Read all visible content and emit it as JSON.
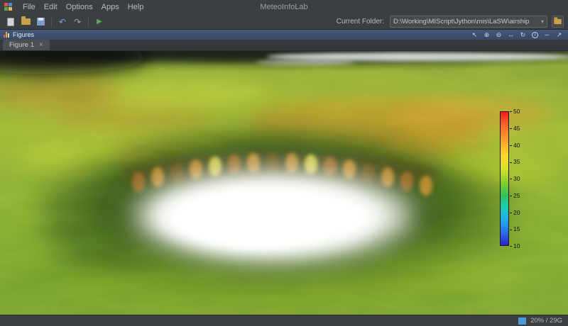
{
  "window": {
    "title": "MeteoInfoLab"
  },
  "menubar": {
    "items": [
      "File",
      "Edit",
      "Options",
      "Apps",
      "Help"
    ]
  },
  "toolbar": {
    "current_folder_label": "Current Folder:",
    "current_folder_value": "D:\\Working\\MIScript\\Jython\\mis\\LaSW\\airship"
  },
  "figures_panel": {
    "title": "Figures"
  },
  "tabs": [
    {
      "label": "Figure 1",
      "close": "×"
    }
  ],
  "figure": {
    "colorbar": {
      "min": 10,
      "max": 50,
      "ticks": [
        "50",
        "45",
        "40",
        "35",
        "30",
        "25",
        "20",
        "15",
        "10"
      ],
      "gradient_top_to_bottom": [
        "#f41b1f",
        "#f8662a",
        "#fba12c",
        "#ffd92b",
        "#d3e32b",
        "#7ecb2f",
        "#2fc25b",
        "#1ccdb9",
        "#22a5ee",
        "#2a64e2",
        "#2d1fd0"
      ]
    }
  },
  "statusbar": {
    "memory_usage": "20% / 29G"
  },
  "icons": {
    "undo": "↶",
    "redo": "↷",
    "run": "▶",
    "chevron_down": "▾",
    "pointer": "↖",
    "zoom_in": "⊕",
    "zoom_out": "⊖",
    "pan": "↔",
    "rotate": "↻",
    "info": "i",
    "minimize": "─",
    "float": "↗"
  },
  "colors": {
    "accent_blue": "#4a88c7",
    "run_green": "#58a758",
    "panel_header_blue": "#3d5574",
    "terrain_green": "#8db13a",
    "terrain_orange": "#cf8a2b",
    "cloud_white": "#ffffff",
    "memory_indicator_blue": "#4d9ad6"
  }
}
